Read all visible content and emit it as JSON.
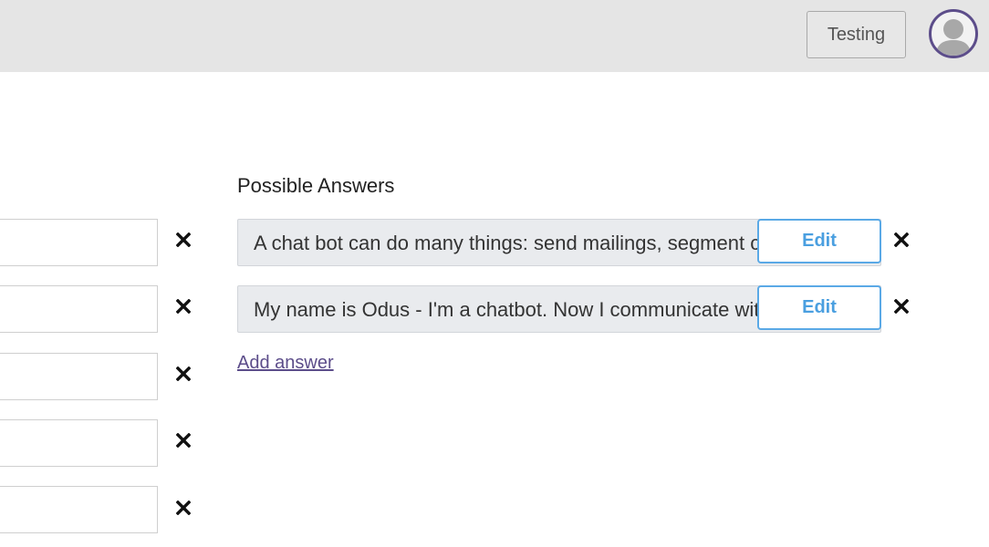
{
  "header": {
    "testing_label": "Testing",
    "avatar_icon": "user-avatar-icon"
  },
  "left_inputs": [
    {
      "value": "",
      "remove_icon": "close-icon"
    },
    {
      "value": "",
      "remove_icon": "close-icon"
    },
    {
      "value": "",
      "remove_icon": "close-icon"
    },
    {
      "value": "",
      "remove_icon": "close-icon"
    },
    {
      "value": "",
      "remove_icon": "close-icon"
    }
  ],
  "answers": {
    "title": "Possible Answers",
    "items": [
      {
        "text": "A chat bot can do many things: send mailings, segment c",
        "edit_label": "Edit"
      },
      {
        "text": "My name is Odus - I'm a chatbot. Now I communicate wit",
        "edit_label": "Edit"
      }
    ],
    "add_label": "Add answer"
  },
  "colors": {
    "accent": "#5c4d8a",
    "edit_blue": "#4a9fe0",
    "topbar": "#e5e5e5"
  }
}
